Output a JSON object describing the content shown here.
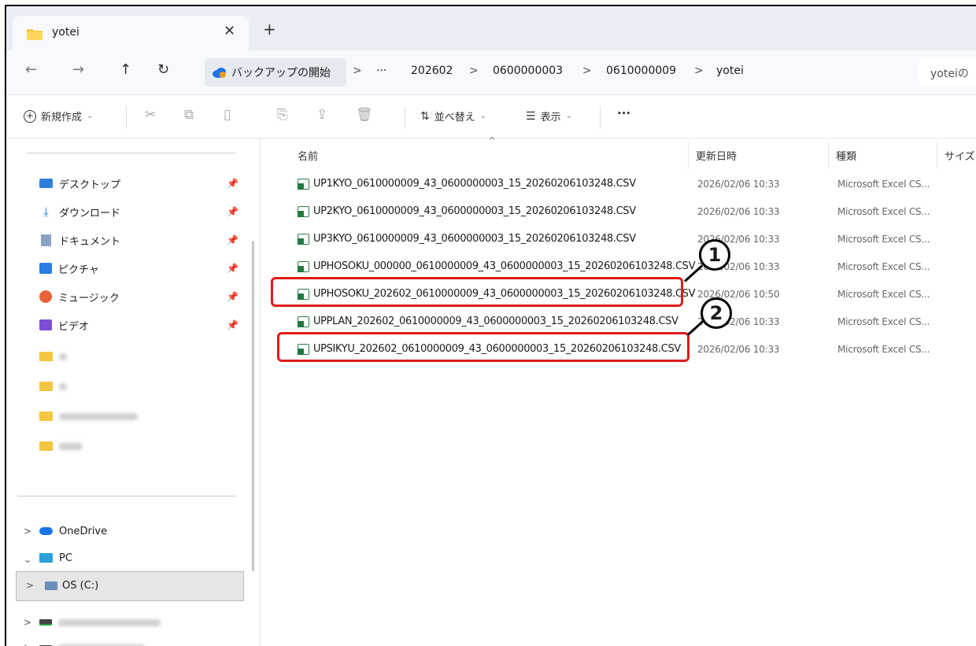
{
  "tab": {
    "title": "yotei",
    "close": "✕",
    "new": "+"
  },
  "nav": {
    "back": "←",
    "forward": "→",
    "up": "↑",
    "refresh": "↻"
  },
  "breadcrumb": {
    "backup": "バックアップの開始",
    "ellipsis": "···",
    "items": [
      "202602",
      "0600000003",
      "0610000009",
      "yotei"
    ],
    "sep": ">"
  },
  "search": {
    "text": "yoteiの"
  },
  "toolbar": {
    "new_label": "新規作成",
    "sort_label": "並べ替え",
    "view_label": "表示",
    "more": "···"
  },
  "sidebar": {
    "quick": [
      {
        "label": "デスクトップ",
        "icon": "desktop-icon"
      },
      {
        "label": "ダウンロード",
        "icon": "download-icon"
      },
      {
        "label": "ドキュメント",
        "icon": "document-icon"
      },
      {
        "label": "ピクチャ",
        "icon": "pictures-icon"
      },
      {
        "label": "ミュージック",
        "icon": "music-icon"
      },
      {
        "label": "ビデオ",
        "icon": "video-icon"
      }
    ],
    "onedrive": "OneDrive",
    "pc": "PC",
    "os": "OS (C:)"
  },
  "columns": {
    "name": "名前",
    "date": "更新日時",
    "type": "種類",
    "size": "サイズ"
  },
  "files": [
    {
      "name": "UP1KYO_0610000009_43_0600000003_15_20260206103248.CSV",
      "date": "2026/02/06 10:33",
      "type": "Microsoft Excel CS..."
    },
    {
      "name": "UP2KYO_0610000009_43_0600000003_15_20260206103248.CSV",
      "date": "2026/02/06 10:33",
      "type": "Microsoft Excel CS..."
    },
    {
      "name": "UP3KYO_0610000009_43_0600000003_15_20260206103248.CSV",
      "date": "2026/02/06 10:33",
      "type": "Microsoft Excel CS..."
    },
    {
      "name": "UPHOSOKU_000000_0610000009_43_0600000003_15_20260206103248.CSV",
      "date": "2026/02/06 10:33",
      "type": "Microsoft Excel CS..."
    },
    {
      "name": "UPHOSOKU_202602_0610000009_43_0600000003_15_20260206103248.CSV",
      "date": "2026/02/06 10:50",
      "type": "Microsoft Excel CS..."
    },
    {
      "name": "UPPLAN_202602_0610000009_43_0600000003_15_20260206103248.CSV",
      "date": "2026/02/06 10:33",
      "type": "Microsoft Excel CS..."
    },
    {
      "name": "UPSIKYU_202602_0610000009_43_0600000003_15_20260206103248.CSV",
      "date": "2026/02/06 10:33",
      "type": "Microsoft Excel CS..."
    }
  ],
  "callouts": [
    "1",
    "2"
  ],
  "colors": {
    "highlight": "#e01b1b",
    "accent": "#0067c0"
  }
}
